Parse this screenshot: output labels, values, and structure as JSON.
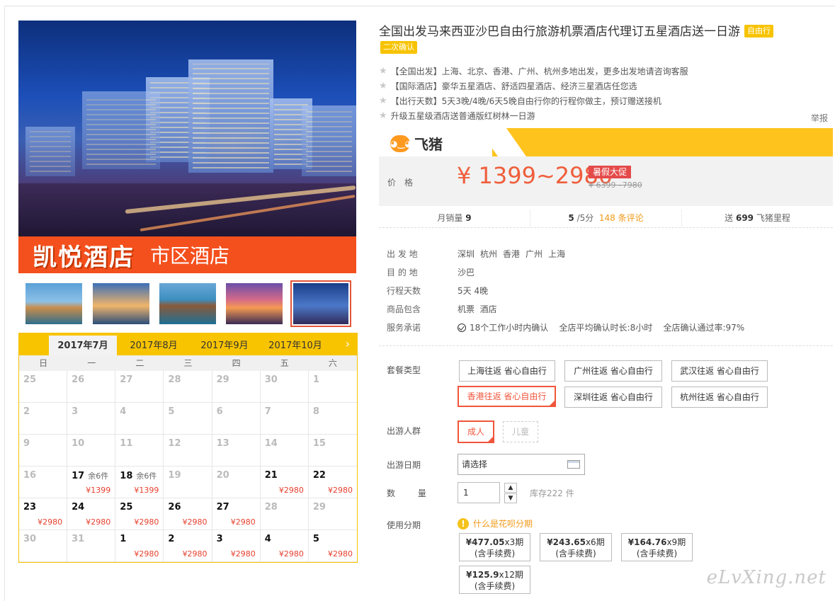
{
  "hero": {
    "banner_main": "凯悦酒店",
    "banner_sub": "市区酒店"
  },
  "calendar": {
    "months": [
      "2017年7月",
      "2017年8月",
      "2017年9月",
      "2017年10月"
    ],
    "next_arrow": "›",
    "weekdays": [
      "日",
      "一",
      "二",
      "三",
      "四",
      "五",
      "六"
    ],
    "cells": [
      {
        "d": "25",
        "on": false,
        "left": "",
        "price": ""
      },
      {
        "d": "26",
        "on": false,
        "left": "",
        "price": ""
      },
      {
        "d": "27",
        "on": false,
        "left": "",
        "price": ""
      },
      {
        "d": "28",
        "on": false,
        "left": "",
        "price": ""
      },
      {
        "d": "29",
        "on": false,
        "left": "",
        "price": ""
      },
      {
        "d": "30",
        "on": false,
        "left": "",
        "price": ""
      },
      {
        "d": "1",
        "on": false,
        "left": "",
        "price": ""
      },
      {
        "d": "2",
        "on": false,
        "left": "",
        "price": ""
      },
      {
        "d": "3",
        "on": false,
        "left": "",
        "price": ""
      },
      {
        "d": "4",
        "on": false,
        "left": "",
        "price": ""
      },
      {
        "d": "5",
        "on": false,
        "left": "",
        "price": ""
      },
      {
        "d": "6",
        "on": false,
        "left": "",
        "price": ""
      },
      {
        "d": "7",
        "on": false,
        "left": "",
        "price": ""
      },
      {
        "d": "8",
        "on": false,
        "left": "",
        "price": ""
      },
      {
        "d": "9",
        "on": false,
        "left": "",
        "price": ""
      },
      {
        "d": "10",
        "on": false,
        "left": "",
        "price": ""
      },
      {
        "d": "11",
        "on": false,
        "left": "",
        "price": ""
      },
      {
        "d": "12",
        "on": false,
        "left": "",
        "price": ""
      },
      {
        "d": "13",
        "on": false,
        "left": "",
        "price": ""
      },
      {
        "d": "14",
        "on": false,
        "left": "",
        "price": ""
      },
      {
        "d": "15",
        "on": false,
        "left": "",
        "price": ""
      },
      {
        "d": "16",
        "on": false,
        "left": "",
        "price": ""
      },
      {
        "d": "17",
        "on": true,
        "left": "余6件",
        "price": "¥1399"
      },
      {
        "d": "18",
        "on": true,
        "left": "余6件",
        "price": "¥1399"
      },
      {
        "d": "19",
        "on": false,
        "left": "",
        "price": ""
      },
      {
        "d": "20",
        "on": false,
        "left": "",
        "price": ""
      },
      {
        "d": "21",
        "on": true,
        "left": "",
        "price": "¥2980"
      },
      {
        "d": "22",
        "on": true,
        "left": "",
        "price": "¥2980"
      },
      {
        "d": "23",
        "on": true,
        "left": "",
        "price": "¥2980"
      },
      {
        "d": "24",
        "on": true,
        "left": "",
        "price": "¥2980"
      },
      {
        "d": "25",
        "on": true,
        "left": "",
        "price": "¥2980"
      },
      {
        "d": "26",
        "on": true,
        "left": "",
        "price": "¥2980"
      },
      {
        "d": "27",
        "on": true,
        "left": "",
        "price": "¥2980"
      },
      {
        "d": "28",
        "on": false,
        "left": "",
        "price": ""
      },
      {
        "d": "29",
        "on": false,
        "left": "",
        "price": ""
      },
      {
        "d": "30",
        "on": false,
        "left": "",
        "price": ""
      },
      {
        "d": "31",
        "on": false,
        "left": "",
        "price": ""
      },
      {
        "d": "1",
        "on": true,
        "left": "",
        "price": "¥2980"
      },
      {
        "d": "2",
        "on": true,
        "left": "",
        "price": "¥2980"
      },
      {
        "d": "3",
        "on": true,
        "left": "",
        "price": "¥2980"
      },
      {
        "d": "4",
        "on": true,
        "left": "",
        "price": "¥2980"
      },
      {
        "d": "5",
        "on": true,
        "left": "",
        "price": "¥2980"
      }
    ]
  },
  "product": {
    "title": "全国出发马来西亚沙巴自由行旅游机票酒店代理订五星酒店送一日游",
    "badge_type": "自由行",
    "badge_confirm": "二次确认",
    "features": [
      "【全国出发】上海、北京、香港、广州、杭州多地出发，更多出发地请咨询客服",
      "【国际酒店】豪华五星酒店、舒适四星酒店、经济三星酒店任您选",
      "【出行天数】5天3晚/4晚/6天5晚自由行你的行程你做主，预订赠送接机",
      "升级五星级酒店送普通版红树林一日游"
    ],
    "report": "举报"
  },
  "pricebar": {
    "brand": "飞猪",
    "price_label": "价格",
    "price": "¥ 1399~2980",
    "promo": "暑假大促",
    "original": "¥ 6399~7980"
  },
  "stats": {
    "monthly_label": "月销量",
    "monthly_value": "9",
    "rating_value": "5",
    "rating_suffix": "/5分",
    "reviews": "148 条评论",
    "miles_prefix": "送",
    "miles_value": "699",
    "miles_suffix": "飞猪里程"
  },
  "info": {
    "depart_label": "出 发 地",
    "depart": [
      "深圳",
      "杭州",
      "香港",
      "广州",
      "上海"
    ],
    "dest_label": "目 的 地",
    "dest": "沙巴",
    "days_label": "行程天数",
    "days": "5天 4晚",
    "includes_label": "商品包含",
    "includes": "机票  酒店",
    "promise_label": "服务承诺",
    "promise": "18个工作小时内确认    全店平均确认时长:8小时    全店确认通过率:97%"
  },
  "options": {
    "package_label": "套餐类型",
    "packages": [
      "上海往返 省心自由行",
      "广州往返 省心自由行",
      "武汉往返 省心自由行",
      "香港往返 省心自由行",
      "深圳往返 省心自由行",
      "杭州往返 省心自由行"
    ],
    "people_label": "出游人群",
    "people": [
      "成人",
      "儿童"
    ],
    "date_label": "出游日期",
    "date_placeholder": "请选择",
    "qty_label": "数 量",
    "qty": "1",
    "stock": "库存222 件",
    "installment_label": "使用分期",
    "huabei": "什么是花呗分期",
    "installments": [
      {
        "amount": "¥477.05",
        "term": "x3期",
        "fee": "(含手续费)"
      },
      {
        "amount": "¥243.65",
        "term": "x6期",
        "fee": "(含手续费)"
      },
      {
        "amount": "¥164.76",
        "term": "x9期",
        "fee": "(含手续费)"
      },
      {
        "amount": "¥125.9",
        "term": "x12期",
        "fee": "(含手续费)"
      }
    ]
  },
  "watermark": "eLvXing.net"
}
